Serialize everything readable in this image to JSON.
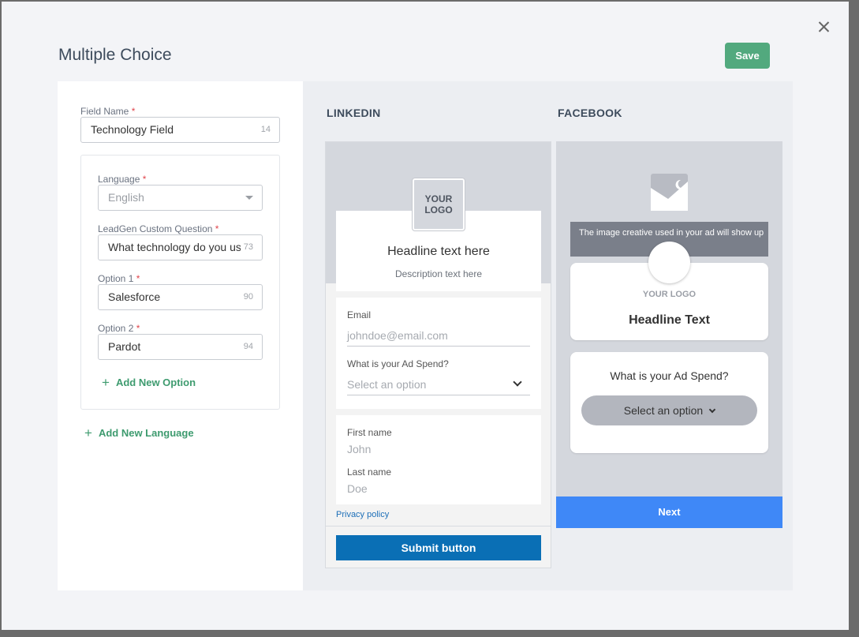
{
  "modal": {
    "title": "Multiple Choice",
    "save_label": "Save"
  },
  "form": {
    "field_name": {
      "label": "Field Name",
      "required_mark": "*",
      "value": "Technology Field",
      "counter": "14"
    },
    "language": {
      "label": "Language",
      "required_mark": "*",
      "value": "English"
    },
    "custom_question": {
      "label": "LeadGen Custom Question",
      "required_mark": "*",
      "value": "What technology do you use?",
      "counter": "73"
    },
    "options": [
      {
        "label": "Option 1",
        "required_mark": "*",
        "value": "Salesforce",
        "counter": "90"
      },
      {
        "label": "Option 2",
        "required_mark": "*",
        "value": "Pardot",
        "counter": "94"
      }
    ],
    "add_option_label": "Add New Option",
    "add_language_label": "Add New Language",
    "plus_glyph": "+"
  },
  "linkedin": {
    "section_title": "LINKEDIN",
    "logo_line1": "YOUR",
    "logo_line2": "LOGO",
    "headline": "Headline text here",
    "description": "Description text here",
    "email_label": "Email",
    "email_placeholder": "johndoe@email.com",
    "question_label": "What is your Ad Spend?",
    "select_placeholder": "Select an option",
    "first_name_label": "First name",
    "first_name_placeholder": "John",
    "last_name_label": "Last name",
    "last_name_placeholder": "Doe",
    "privacy_label": "Privacy policy",
    "submit_label": "Submit button",
    "submit_color": "#0a6fb5"
  },
  "facebook": {
    "section_title": "FACEBOOK",
    "banner_text": "The image creative used in your ad will show up",
    "logo_text": "YOUR LOGO",
    "headline": "Headline Text",
    "question": "What is your Ad Spend?",
    "select_label": "Select an option",
    "next_label": "Next",
    "next_color": "#3f88f7"
  },
  "icons": {
    "close": "close-icon",
    "plus": "plus-icon",
    "image_placeholder": "image-icon",
    "dropdown": "chevron-down-icon"
  },
  "colors": {
    "accent_green": "#52a97e",
    "required_red": "#e0454c",
    "link_green": "#3e9b6f"
  }
}
